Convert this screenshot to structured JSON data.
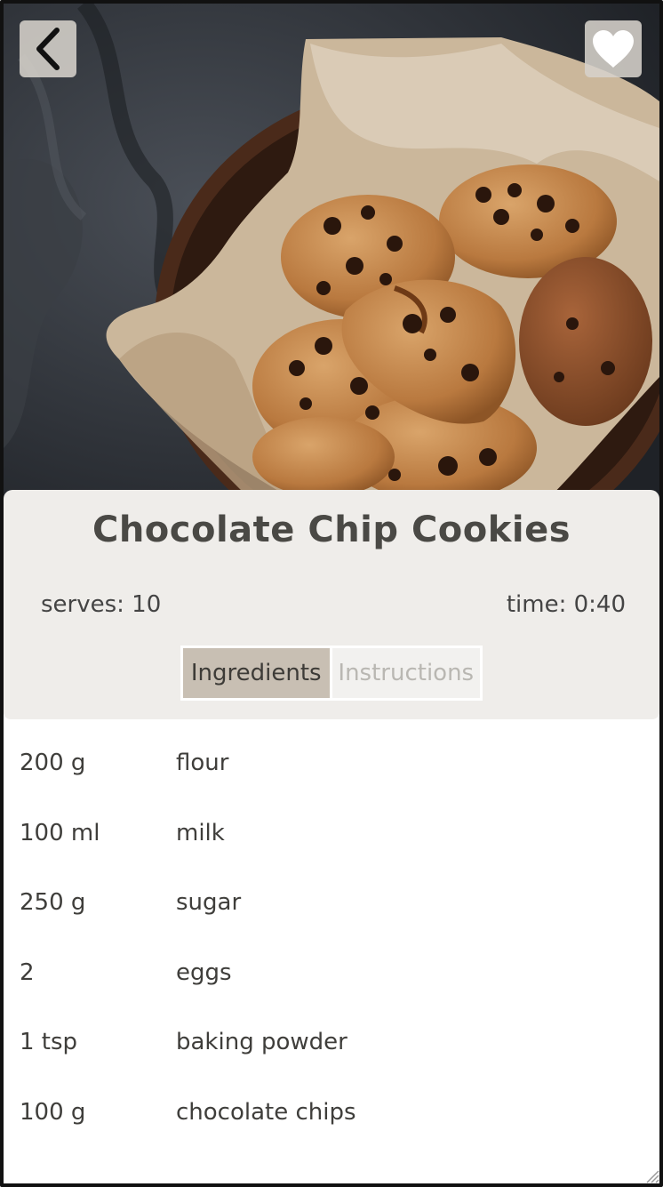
{
  "nav": {
    "back_icon": "chevron-left-icon",
    "favorite_icon": "heart-icon"
  },
  "hero": {
    "image_subject": "chocolate chip cookies in a bowl"
  },
  "recipe": {
    "title": "Chocolate Chip Cookies",
    "serves": "serves: 10",
    "time": "time: 0:40"
  },
  "tabs": [
    {
      "label": "Ingredients",
      "active": true
    },
    {
      "label": "Instructions",
      "active": false
    }
  ],
  "ingredients": [
    {
      "quantity": "200 g",
      "name": "flour"
    },
    {
      "quantity": "100 ml",
      "name": "milk"
    },
    {
      "quantity": "250 g",
      "name": "sugar"
    },
    {
      "quantity": "2",
      "name": "eggs"
    },
    {
      "quantity": "1 tsp",
      "name": "baking powder"
    },
    {
      "quantity": "100 g",
      "name": "chocolate chips"
    }
  ],
  "colors": {
    "card_bg": "#efedea",
    "tab_active": "#c8bfb3",
    "tab_inactive_text": "#b9b7b2",
    "text": "#3f3e3b",
    "button_bg": "#d6d2cb"
  }
}
